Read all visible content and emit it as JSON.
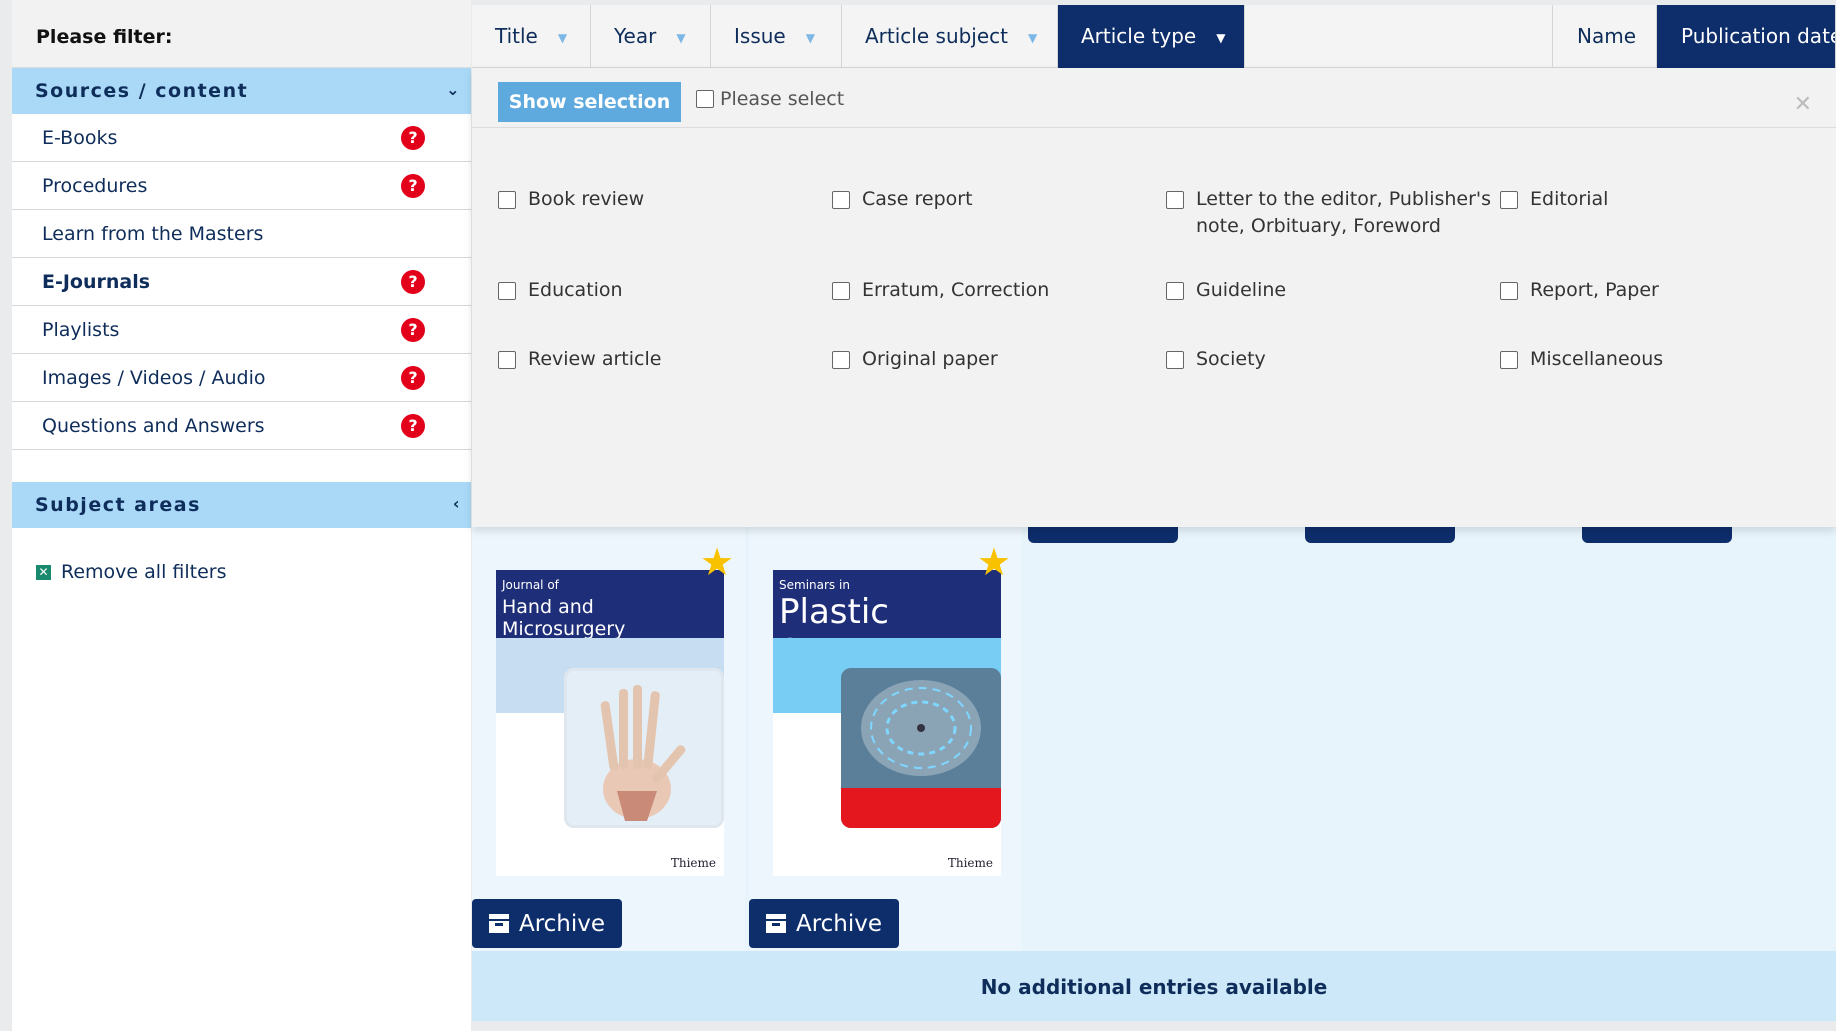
{
  "sidebar": {
    "title": "Please filter:",
    "sources_header": "Sources / content",
    "sources_chevron": "⌄",
    "items": [
      {
        "label": "E-Books",
        "help": "?"
      },
      {
        "label": "Procedures",
        "help": "?"
      },
      {
        "label": "Learn from the Masters"
      },
      {
        "label": "E-Journals",
        "help": "?"
      },
      {
        "label": "Playlists",
        "help": "?"
      },
      {
        "label": "Images / Videos / Audio",
        "help": "?"
      },
      {
        "label": "Questions and Answers",
        "help": "?"
      }
    ],
    "subject_header": "Subject areas",
    "subject_chevron": "‹",
    "remove_filters": "Remove all filters",
    "remove_icon": "✕"
  },
  "tabs": [
    {
      "label": "Title"
    },
    {
      "label": "Year"
    },
    {
      "label": "Issue"
    },
    {
      "label": "Article subject"
    },
    {
      "label": "Article type"
    },
    {
      "label": "Name"
    },
    {
      "label": "Publication date"
    }
  ],
  "caret": "▼",
  "panel": {
    "show_selection": "Show selection",
    "please_select": "Please select",
    "close": "✕",
    "options": [
      "Book review",
      "Case report",
      "Letter to the editor, Publisher's note, Orbituary, Foreword",
      "Editorial",
      "Education",
      "Erratum, Correction",
      "Guideline",
      "Report, Paper",
      "Review article",
      "Original paper",
      "Society",
      "Miscellaneous"
    ]
  },
  "journals": [
    {
      "small": "Journal of",
      "big": "Hand and Microsurgery",
      "publisher": "Thieme",
      "archive": "Archive",
      "star": "★"
    },
    {
      "small": "Seminars in",
      "big": "Plastic Surgery",
      "publisher": "Thieme",
      "archive": "Archive",
      "star": "★"
    }
  ],
  "footer": {
    "no_more": "No additional entries available"
  }
}
